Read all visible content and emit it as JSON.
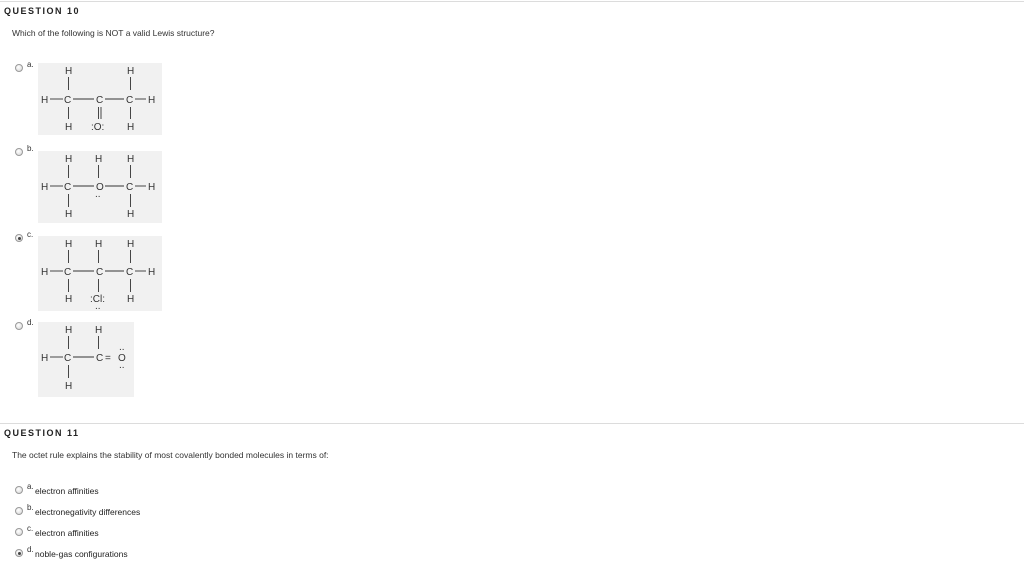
{
  "question10": {
    "title": "QUESTION 10",
    "prompt": "Which of the following is NOT a valid Lewis structure?",
    "options": [
      {
        "letter": "a.",
        "selected": false
      },
      {
        "letter": "b.",
        "selected": false
      },
      {
        "letter": "c.",
        "selected": true
      },
      {
        "letter": "d.",
        "selected": false
      }
    ],
    "structures": {
      "a": {
        "H": "H",
        "C": "C",
        "O": ":O:"
      },
      "b": {
        "H": "H",
        "C": "C",
        "O": "O",
        "lone_pair": ".."
      },
      "c": {
        "H": "H",
        "C": "C",
        "Cl": ":Cl:",
        "lone_pair": ".."
      },
      "d": {
        "H": "H",
        "C": "C",
        "O": "O",
        "eq": "=",
        "lone_pair": "..",
        "side_pair": ":"
      }
    }
  },
  "question11": {
    "title": "QUESTION 11",
    "prompt": "The octet rule explains the stability of most covalently bonded molecules in terms of:",
    "options": [
      {
        "letter": "a.",
        "text": "electron affinities",
        "selected": false
      },
      {
        "letter": "b.",
        "text": "electronegativity differences",
        "selected": false
      },
      {
        "letter": "c.",
        "text": "electron affinities",
        "selected": false
      },
      {
        "letter": "d.",
        "text": "noble-gas configurations",
        "selected": true
      }
    ]
  }
}
